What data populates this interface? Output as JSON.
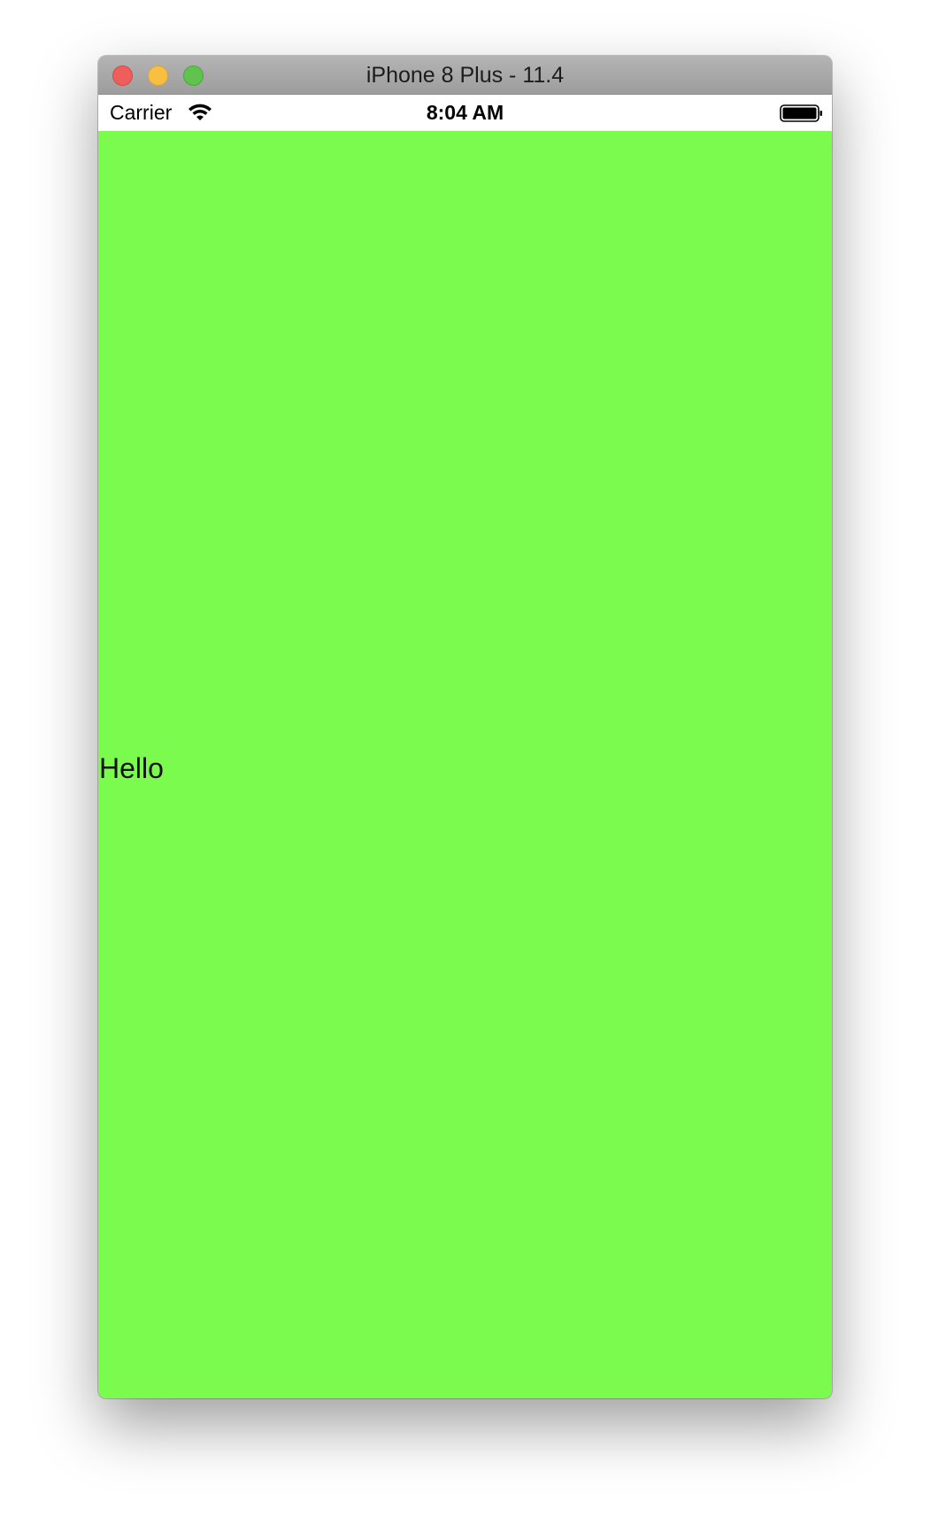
{
  "window": {
    "title": "iPhone 8 Plus - 11.4",
    "controls": [
      "close",
      "minimize",
      "zoom"
    ]
  },
  "status_bar": {
    "carrier": "Carrier",
    "time": "8:04 AM",
    "wifi_icon": "wifi-icon",
    "battery_icon": "battery-icon"
  },
  "screen": {
    "background_color": "#7afb4e",
    "label": "Hello"
  }
}
